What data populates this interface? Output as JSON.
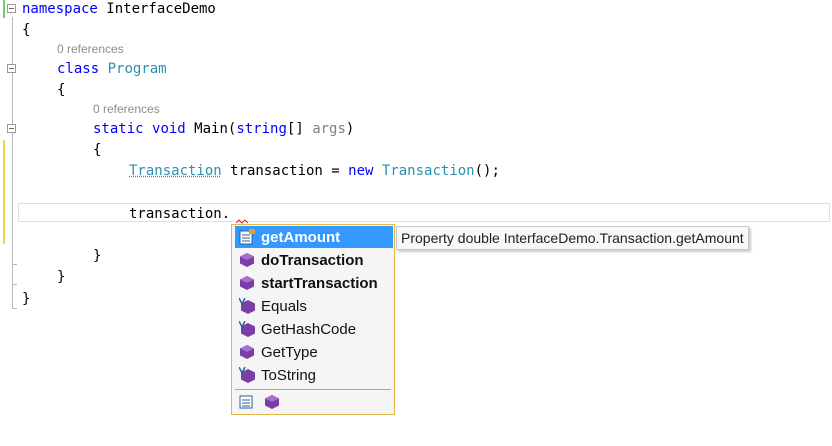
{
  "colors": {
    "keyword": "#0000ff",
    "type": "#2b91af",
    "selection": "#3399ff",
    "popup_border": "#e0b84a",
    "change_bar": "#e8d44d",
    "method_icon": "#7a3fa5"
  },
  "code": {
    "l1_kw": "namespace",
    "l1_name": " InterfaceDemo",
    "l2": "{",
    "refs1": "0 references",
    "l3_kw": "class",
    "l3_type": "Program",
    "l4": "{",
    "refs2": "0 references",
    "l5_kw1": "static",
    "l5_kw2": "void",
    "l5_name": "Main(",
    "l5_kw3": "string",
    "l5_rest": "[] ",
    "l5_param": "args",
    "l5_close": ")",
    "l6": "{",
    "l7_type1": "Transaction",
    "l7_mid": " transaction = ",
    "l7_kw": "new",
    "l7_type2": "Transaction",
    "l7_end": "();",
    "l8": "transaction.",
    "l9": "}",
    "l10": "}",
    "l11": "}"
  },
  "intellisense": {
    "items": [
      {
        "label": "getAmount",
        "icon": "property-icon",
        "selected": true
      },
      {
        "label": "doTransaction",
        "icon": "method-icon",
        "bold": true
      },
      {
        "label": "startTransaction",
        "icon": "method-icon",
        "bold": true
      },
      {
        "label": "Equals",
        "icon": "extension-method-icon"
      },
      {
        "label": "GetHashCode",
        "icon": "extension-method-icon"
      },
      {
        "label": "GetType",
        "icon": "method-icon"
      },
      {
        "label": "ToString",
        "icon": "extension-method-icon"
      }
    ],
    "filters": [
      "property-filter-icon",
      "method-filter-icon"
    ]
  },
  "tooltip": "Property double InterfaceDemo.Transaction.getAmount"
}
